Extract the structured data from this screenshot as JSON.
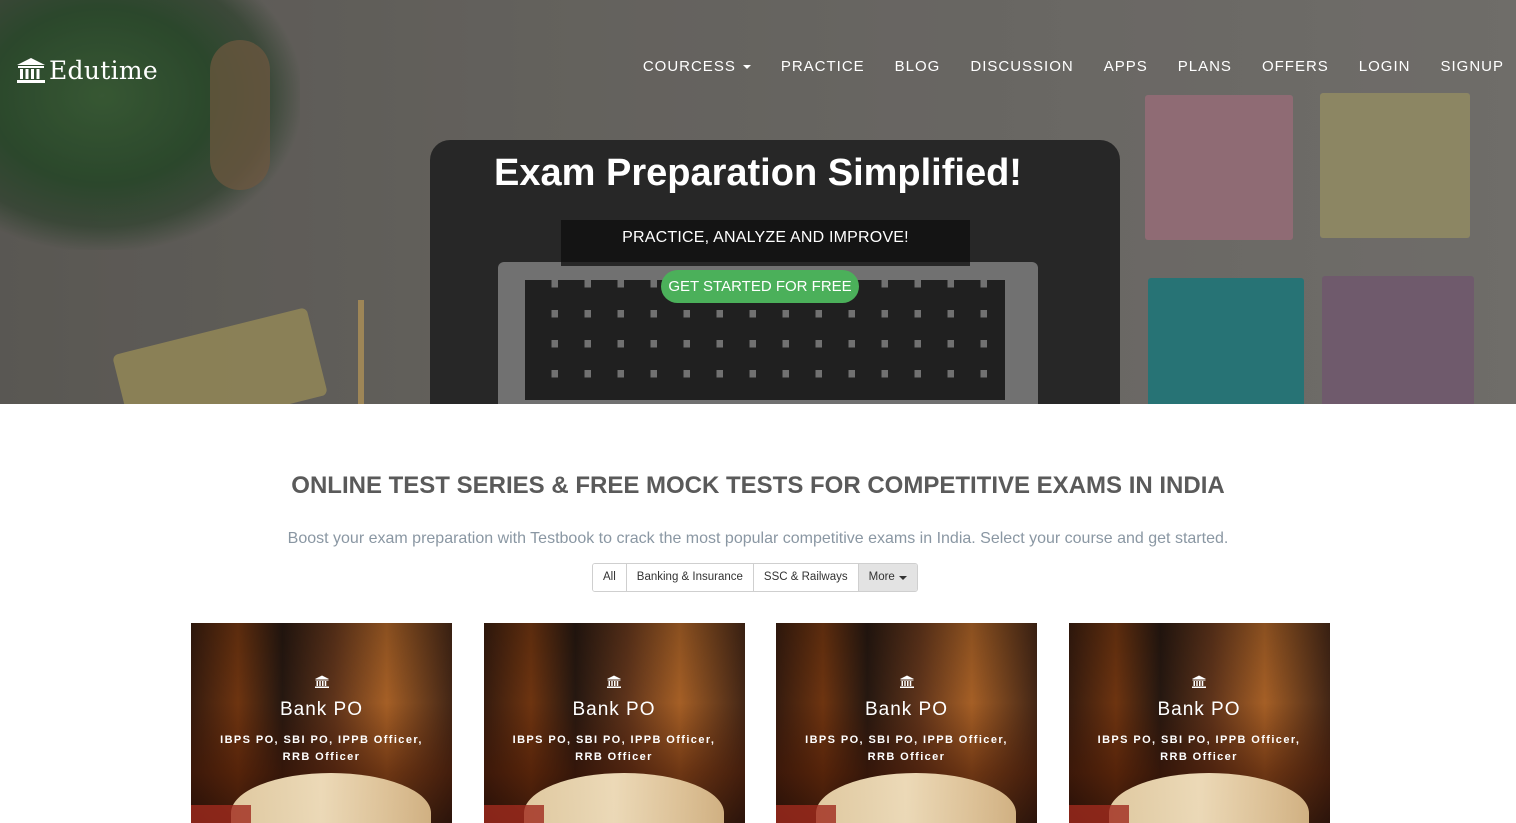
{
  "brand": {
    "name": "Edutime",
    "icon": "bank-icon"
  },
  "nav": {
    "items": [
      {
        "label": "COURCESS",
        "dropdown": true
      },
      {
        "label": "PRACTICE",
        "dropdown": false
      },
      {
        "label": "BLOG",
        "dropdown": false
      },
      {
        "label": "DISCUSSION",
        "dropdown": false
      },
      {
        "label": "APPS",
        "dropdown": false
      },
      {
        "label": "PLANS",
        "dropdown": false
      },
      {
        "label": "OFFERS",
        "dropdown": false
      },
      {
        "label": "LOGIN",
        "dropdown": false
      },
      {
        "label": "SIGNUP",
        "dropdown": false
      }
    ]
  },
  "hero": {
    "title": "Exam Preparation Simplified!",
    "subtitle": "PRACTICE, ANALYZE AND IMPROVE!",
    "cta_label": "GET STARTED FOR FREE"
  },
  "main": {
    "title": "ONLINE TEST SERIES & FREE MOCK TESTS FOR COMPETITIVE EXAMS IN INDIA",
    "description": "Boost your exam preparation with Testbook to crack the most popular competitive exams in India. Select your course and get started.",
    "filters": [
      {
        "label": "All"
      },
      {
        "label": "Banking & Insurance"
      },
      {
        "label": "SSC & Railways"
      },
      {
        "label": "More"
      }
    ],
    "cards": [
      {
        "title": "Bank PO",
        "subtitle": "IBPS PO, SBI PO, IPPB Officer, RRB Officer",
        "icon": "bank-icon"
      },
      {
        "title": "Bank PO",
        "subtitle": "IBPS PO, SBI PO, IPPB Officer, RRB Officer",
        "icon": "bank-icon"
      },
      {
        "title": "Bank PO",
        "subtitle": "IBPS PO, SBI PO, IPPB Officer, RRB Officer",
        "icon": "bank-icon"
      },
      {
        "title": "Bank PO",
        "subtitle": "IBPS PO, SBI PO, IPPB Officer, RRB Officer",
        "icon": "bank-icon"
      }
    ]
  },
  "colors": {
    "cta": "#4bb05a",
    "title_text": "#5a5a5a",
    "desc_text": "#8a97a3"
  }
}
